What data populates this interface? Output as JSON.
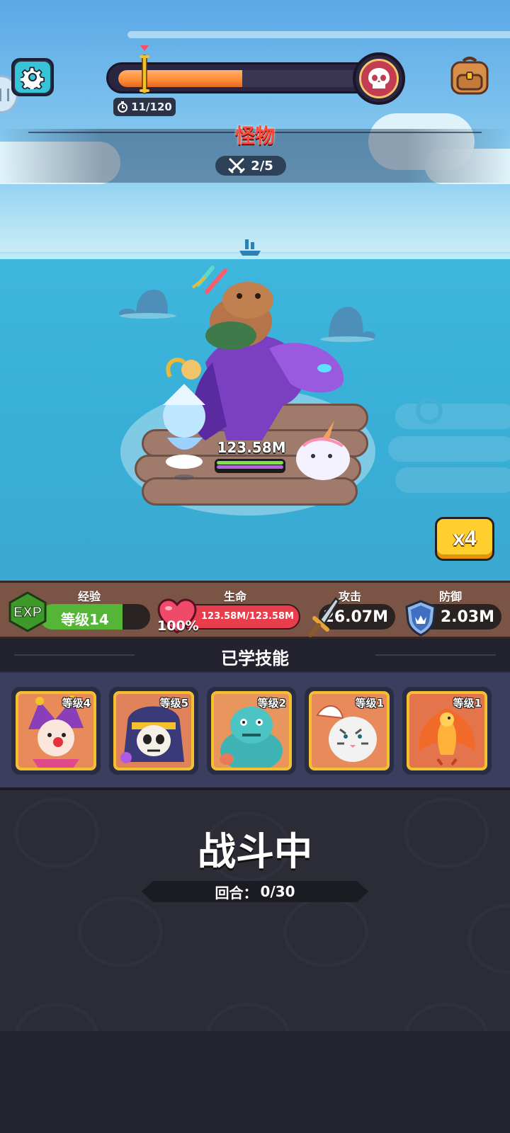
{
  "hud": {
    "timer": "11/120",
    "progress_fraction": 0.5,
    "stage_title": "怪物",
    "wave": "2/5"
  },
  "battle": {
    "hero_hp": "123.58M",
    "speed_label": "x4"
  },
  "stats": {
    "exp_label": "经验",
    "exp_badge": "EXP",
    "level_text": "等级14",
    "exp_fraction": 0.75,
    "hp_label": "生命",
    "hp_percent": "100%",
    "hp_value": "123.58M/123.58M",
    "atk_label": "攻击",
    "atk_value": "26.07M",
    "def_label": "防御",
    "def_value": "2.03M"
  },
  "skills": {
    "header": "已学技能",
    "items": [
      {
        "level": "等级4",
        "icon": "jester-icon",
        "bg": "#e98a5a"
      },
      {
        "level": "等级5",
        "icon": "pharaoh-skull-icon",
        "bg": "#e0825a"
      },
      {
        "level": "等级2",
        "icon": "ogre-icon",
        "bg": "#e9965e"
      },
      {
        "level": "等级1",
        "icon": "winged-tiger-icon",
        "bg": "#e88a5c"
      },
      {
        "level": "等级1",
        "icon": "phoenix-icon",
        "bg": "#e3744c"
      }
    ]
  },
  "status": {
    "title": "战斗中",
    "round_label": "回合：",
    "round_value": "0/30"
  },
  "colors": {
    "accent_yellow": "#ffcf2e",
    "hp_red": "#e83d4c",
    "exp_green": "#55b536",
    "progress_orange": "#ff8a35"
  }
}
